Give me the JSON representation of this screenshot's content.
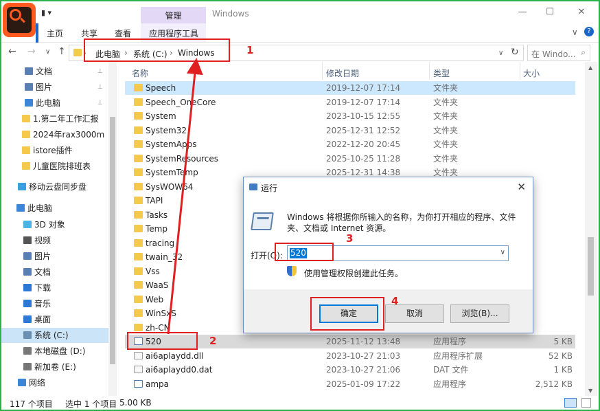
{
  "window": {
    "title": "Windows",
    "context_tab": "管理",
    "minimize": "—",
    "maximize": "☐",
    "close": "✕"
  },
  "ribbon": {
    "home": "主页",
    "share": "共享",
    "view": "查看",
    "app_tools": "应用程序工具",
    "collapse": "∨",
    "help": "?"
  },
  "address": {
    "crumbs": [
      "此电脑",
      "系统 (C:)",
      "Windows"
    ],
    "sep": "›",
    "refresh": "↻",
    "search_placeholder": "在 Windo...",
    "dropdown": "∨",
    "back": "←",
    "forward": "→",
    "recent": "∨",
    "up": "↑"
  },
  "nav": {
    "items": [
      {
        "label": "文档",
        "pinned": true,
        "color": "#5a7fb5"
      },
      {
        "label": "图片",
        "pinned": true,
        "color": "#5a7fb5"
      },
      {
        "label": "此电脑",
        "pinned": true,
        "color": "#3b86d6"
      },
      {
        "label": "1.第二年工作汇报",
        "pinned": false,
        "color": "#f4c94c"
      },
      {
        "label": "2024年rax3000m",
        "pinned": false,
        "color": "#f4c94c"
      },
      {
        "label": "istore插件",
        "pinned": false,
        "color": "#f4c94c"
      },
      {
        "label": "儿童医院排班表",
        "pinned": false,
        "color": "#f4c94c"
      },
      {
        "label": "移动云盘同步盘",
        "pinned": false,
        "color": "#3aa0e0"
      },
      {
        "label": "此电脑",
        "pinned": false,
        "color": "#3b86d6"
      },
      {
        "label": "3D 对象",
        "pinned": false,
        "color": "#49b4e3"
      },
      {
        "label": "视频",
        "pinned": false,
        "color": "#555"
      },
      {
        "label": "图片",
        "pinned": false,
        "color": "#5a7fb5"
      },
      {
        "label": "文档",
        "pinned": false,
        "color": "#5a7fb5"
      },
      {
        "label": "下载",
        "pinned": false,
        "color": "#2c7ad6"
      },
      {
        "label": "音乐",
        "pinned": false,
        "color": "#2c7ad6"
      },
      {
        "label": "桌面",
        "pinned": false,
        "color": "#2c7ad6"
      },
      {
        "label": "系统 (C:)",
        "pinned": false,
        "color": "#6a8fb3"
      },
      {
        "label": "本地磁盘 (D:)",
        "pinned": false,
        "color": "#777"
      },
      {
        "label": "新加卷 (E:)",
        "pinned": false,
        "color": "#777"
      },
      {
        "label": "网络",
        "pinned": false,
        "color": "#3b86d6"
      }
    ],
    "pin_icon": "📌"
  },
  "columns": {
    "name": "名称",
    "date": "修改日期",
    "type": "类型",
    "size": "大小"
  },
  "files": [
    {
      "name": "Speech",
      "date": "2019-12-07 17:14",
      "type": "文件夹",
      "size": "",
      "kind": "folder"
    },
    {
      "name": "Speech_OneCore",
      "date": "2019-12-07 17:14",
      "type": "文件夹",
      "size": "",
      "kind": "folder"
    },
    {
      "name": "System",
      "date": "2023-10-15 12:55",
      "type": "文件夹",
      "size": "",
      "kind": "folder"
    },
    {
      "name": "System32",
      "date": "2025-12-31 12:52",
      "type": "文件夹",
      "size": "",
      "kind": "folder"
    },
    {
      "name": "SystemApps",
      "date": "2022-12-20 20:45",
      "type": "文件夹",
      "size": "",
      "kind": "folder"
    },
    {
      "name": "SystemResources",
      "date": "2025-10-25 11:28",
      "type": "文件夹",
      "size": "",
      "kind": "folder"
    },
    {
      "name": "SystemTemp",
      "date": "2025-12-31 14:38",
      "type": "文件夹",
      "size": "",
      "kind": "folder"
    },
    {
      "name": "SysWOW64",
      "date": "",
      "type": "",
      "size": "",
      "kind": "folder"
    },
    {
      "name": "TAPI",
      "date": "",
      "type": "",
      "size": "",
      "kind": "folder"
    },
    {
      "name": "Tasks",
      "date": "",
      "type": "",
      "size": "",
      "kind": "folder"
    },
    {
      "name": "Temp",
      "date": "",
      "type": "",
      "size": "",
      "kind": "folder"
    },
    {
      "name": "tracing",
      "date": "",
      "type": "",
      "size": "",
      "kind": "folder"
    },
    {
      "name": "twain_32",
      "date": "",
      "type": "",
      "size": "",
      "kind": "folder"
    },
    {
      "name": "Vss",
      "date": "",
      "type": "",
      "size": "",
      "kind": "folder"
    },
    {
      "name": "WaaS",
      "date": "",
      "type": "",
      "size": "",
      "kind": "folder"
    },
    {
      "name": "Web",
      "date": "",
      "type": "",
      "size": "",
      "kind": "folder"
    },
    {
      "name": "WinSxS",
      "date": "",
      "type": "",
      "size": "",
      "kind": "folder"
    },
    {
      "name": "zh-CN",
      "date": "",
      "type": "",
      "size": "",
      "kind": "folder"
    },
    {
      "name": "520",
      "date": "2025-11-12 13:48",
      "type": "应用程序",
      "size": "5 KB",
      "kind": "app"
    },
    {
      "name": "ai6aplaydd.dll",
      "date": "2023-10-27 21:03",
      "type": "应用程序扩展",
      "size": "52 KB",
      "kind": "dll"
    },
    {
      "name": "ai6aplaydd0.dat",
      "date": "2023-10-27 21:06",
      "type": "DAT 文件",
      "size": "1 KB",
      "kind": "dll"
    },
    {
      "name": "ampa",
      "date": "2025-01-09 17:22",
      "type": "应用程序",
      "size": "2,512 KB",
      "kind": "app"
    }
  ],
  "status": {
    "count": "117 个项目",
    "selected": "选中 1 个项目",
    "size": "5.00 KB"
  },
  "dialog": {
    "title": "运行",
    "close": "✕",
    "description": "Windows 将根据你所输入的名称，为你打开相应的程序、文件夹、文档或 Internet 资源。",
    "open_label": "打开(O):",
    "input_value": "520",
    "input_arrow": "∨",
    "admin_text": "使用管理权限创建此任务。",
    "ok": "确定",
    "cancel": "取消",
    "browse": "浏览(B)..."
  },
  "annotations": {
    "n1": "1",
    "n2": "2",
    "n3": "3",
    "n4": "4"
  },
  "colors": {
    "annotation": "#e02020",
    "frame": "#2ab24a",
    "context_tab": "#e4d8f7"
  }
}
